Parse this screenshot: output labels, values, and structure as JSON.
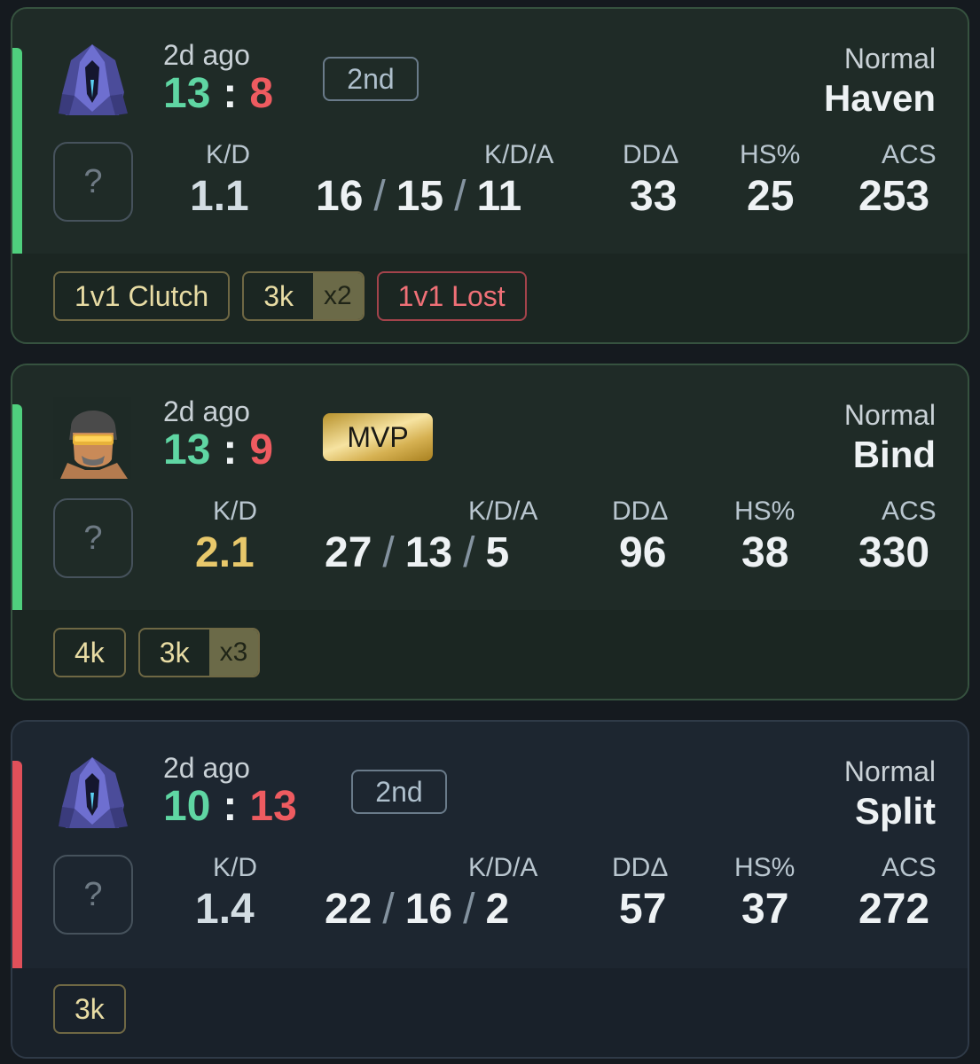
{
  "matches": [
    {
      "result": "win",
      "time_ago": "2d ago",
      "score_team": "13",
      "score_sep": ":",
      "score_enemy": "8",
      "placement": "2nd",
      "mode": "Normal",
      "map": "Haven",
      "rank": "?",
      "agent_icon": "hooded-agent-icon",
      "kd_label": "K/D",
      "kd": "1.1",
      "kda_label": "K/D/A",
      "kills": "16",
      "deaths": "15",
      "assists": "11",
      "slash": "/",
      "dd_label": "DDΔ",
      "dd": "33",
      "hs_label": "HS%",
      "hs": "25",
      "acs_label": "ACS",
      "acs": "253",
      "badges": [
        {
          "text": "1v1 Clutch"
        },
        {
          "text": "3k",
          "mult": "x2"
        },
        {
          "text": "1v1 Lost",
          "color": "#f07077"
        }
      ]
    },
    {
      "result": "win",
      "time_ago": "2d ago",
      "score_team": "13",
      "score_sep": ":",
      "score_enemy": "9",
      "mvp": "MVP",
      "mode": "Normal",
      "map": "Bind",
      "rank": "?",
      "agent_icon": "visor-agent-icon",
      "kd_label": "K/D",
      "kd": "2.1",
      "kda_label": "K/D/A",
      "kills": "27",
      "deaths": "13",
      "assists": "5",
      "slash": "/",
      "dd_label": "DDΔ",
      "dd": "96",
      "hs_label": "HS%",
      "hs": "38",
      "acs_label": "ACS",
      "acs": "330",
      "badges": [
        {
          "text": "4k"
        },
        {
          "text": "3k",
          "mult": "x3"
        }
      ]
    },
    {
      "result": "loss",
      "time_ago": "2d ago",
      "score_team": "10",
      "score_sep": ":",
      "score_enemy": "13",
      "placement": "2nd",
      "mode": "Normal",
      "map": "Split",
      "rank": "?",
      "agent_icon": "hooded-agent-icon",
      "kd_label": "K/D",
      "kd": "1.4",
      "kda_label": "K/D/A",
      "kills": "22",
      "deaths": "16",
      "assists": "2",
      "slash": "/",
      "dd_label": "DDΔ",
      "dd": "57",
      "hs_label": "HS%",
      "hs": "37",
      "acs_label": "ACS",
      "acs": "272",
      "badges": [
        {
          "text": "3k"
        }
      ]
    }
  ],
  "colors": {
    "win": "#4fcf7d",
    "loss": "#e0505a",
    "score_team": "#5fd6a3",
    "score_enemy": "#ee5b60",
    "kd_highlight": "#e8c86b"
  }
}
